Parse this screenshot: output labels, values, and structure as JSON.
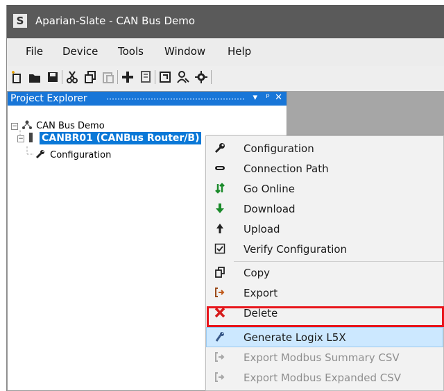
{
  "window": {
    "app_icon": "S",
    "title": "Aparian-Slate  - CAN Bus Demo"
  },
  "menubar": {
    "items": [
      "File",
      "Device",
      "Tools",
      "Window",
      "Help"
    ]
  },
  "toolbar": {
    "icons": [
      "new-project-icon",
      "open-icon",
      "save-icon",
      "cut-icon",
      "copy-icon",
      "paste-icon",
      "add-device-icon",
      "properties-icon",
      "verify-icon",
      "users-icon",
      "settings-icon"
    ]
  },
  "explorer": {
    "title": "Project Explorer",
    "dropdown_glyph": "▾",
    "pin_glyph": "ᵖ",
    "close_glyph": "✕",
    "tree": {
      "root": "CAN Bus Demo",
      "device": "CANBR01 (CANBus Router/B)",
      "child": "Configuration"
    }
  },
  "context_menu": {
    "items": [
      {
        "label": "Configuration",
        "icon": "wrench-icon",
        "enabled": true
      },
      {
        "label": "Connection Path",
        "icon": "link-icon",
        "enabled": true
      },
      {
        "label": "Go Online",
        "icon": "go-online-icon",
        "enabled": true
      },
      {
        "label": "Download",
        "icon": "download-arrow-icon",
        "enabled": true
      },
      {
        "label": "Upload",
        "icon": "upload-arrow-icon",
        "enabled": true
      },
      {
        "label": "Verify Configuration",
        "icon": "checkbox-icon",
        "enabled": true
      },
      {
        "label": "Copy",
        "icon": "copy-icon",
        "enabled": true
      },
      {
        "label": "Export",
        "icon": "export-icon",
        "enabled": true
      },
      {
        "label": "Delete",
        "icon": "delete-x-icon",
        "enabled": true
      },
      {
        "label": "Generate Logix L5X",
        "icon": "logix-icon",
        "enabled": true,
        "highlighted": true
      },
      {
        "label": "Export Modbus Summary CSV",
        "icon": "export-icon",
        "enabled": false
      },
      {
        "label": "Export Modbus Expanded CSV",
        "icon": "export-icon",
        "enabled": false
      }
    ]
  },
  "colors": {
    "explorer_header": "#1876d8",
    "selection": "#0a78d7",
    "highlight_outline": "#e8151b",
    "menu_highlight": "#cce8ff"
  }
}
